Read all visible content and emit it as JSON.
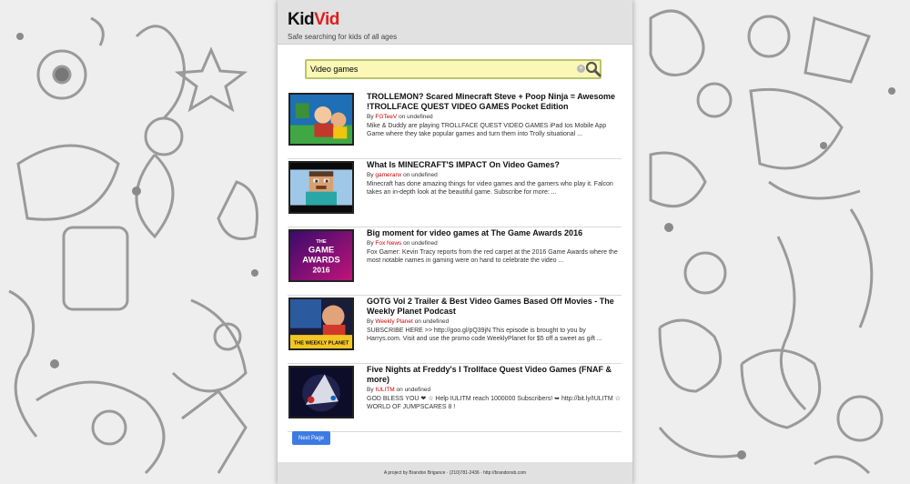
{
  "app": {
    "logo_kid": "Kid",
    "logo_vid": "Vid",
    "tagline": "Safe searching for kids of all ages"
  },
  "search": {
    "value": "Video games",
    "placeholder": ""
  },
  "results": [
    {
      "title": "TROLLEMON? Scared Minecraft Steve + Poop Ninja = Awesome !TROLLFACE QUEST VIDEO GAMES Pocket Edition",
      "by_prefix": "By",
      "channel": "FGTeeV",
      "on_text": "on undefined",
      "description": "Mike & Duddy are playing TROLLFACE QUEST VIDEO GAMES iPad Ios Mobile App Game where they take popular games and turn them into Trolly situational ..."
    },
    {
      "title": "What Is MINECRAFT'S IMPACT On Video Games?",
      "by_prefix": "By",
      "channel": "gameranx",
      "on_text": "on undefined",
      "description": "Minecraft has done amazing things for video games and the gamers who play it. Falcon takes an in-depth look at the beautiful game. Subscribe for more: ..."
    },
    {
      "title": "Big moment for video games at The Game Awards 2016",
      "by_prefix": "By",
      "channel": "Fox News",
      "on_text": "on undefined",
      "description": "Fox Gamer: Kevin Tracy reports from the red carpet at the 2016 Game Awards where the most notable names in gaming were on hand to celebrate the video ..."
    },
    {
      "title": "GOTG Vol 2 Trailer & Best Video Games Based Off Movies - The Weekly Planet Podcast",
      "by_prefix": "By",
      "channel": "Weekly Planet",
      "on_text": "on undefined",
      "description": "SUBSCRIBE HERE >> http://goo.gl/pQ39jN This episode is brought to you by Harrys.com. Visit and use the promo code WeeklyPlanet for $5 off a sweet as gift ..."
    },
    {
      "title": "Five Nights at Freddy's I Trollface Quest Video Games (FNAF & more)",
      "by_prefix": "By",
      "channel": "IULITM",
      "on_text": "on undefined",
      "description": "GOD BLESS YOU ❤ ☆ Help IULITM reach 1000000 Subscribers! ➥ http://bit.ly/IULITM ☆ WORLD OF JUMPSCARES 8 !"
    }
  ],
  "thumb_texts": {
    "game_awards_1": "THE",
    "game_awards_2": "GAME",
    "game_awards_3": "AWARDS",
    "game_awards_4": "2016",
    "weekly_planet": "THE WEEKLY PLANET"
  },
  "pagination": {
    "next_label": "Next Page"
  },
  "footer": {
    "text": "A project by Brandon Brigance  ·  (210)781-2436  ·  http://brandonsb.com"
  },
  "colors": {
    "logo_accent": "#e01d1d",
    "channel_link": "#cc0000",
    "next_button": "#3d7be3",
    "search_bg": "#fbf7b6"
  },
  "icons": {
    "search": "search-icon",
    "clear": "clear-icon"
  }
}
